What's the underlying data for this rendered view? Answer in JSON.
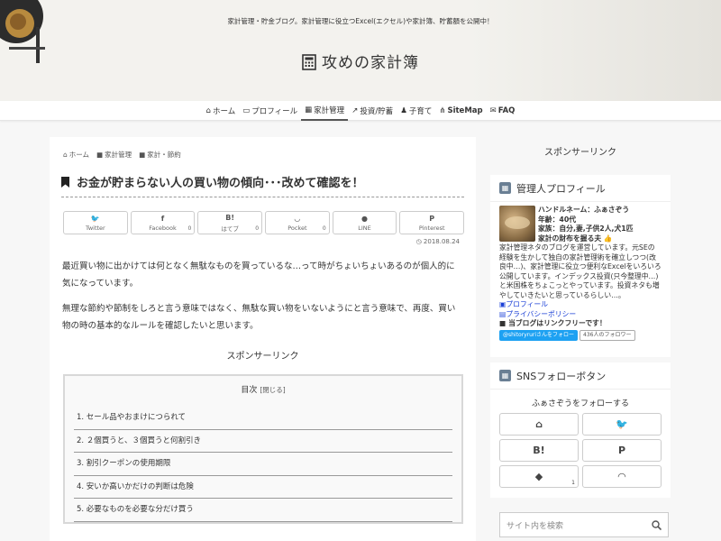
{
  "header": {
    "tagline": "家計管理・貯金ブログ。家計管理に役立つExcel(エクセル)や家計簿、貯蓄額を公開中！",
    "site_title": "攻めの家計簿"
  },
  "nav": [
    {
      "label": "ホーム",
      "icon": "home-icon"
    },
    {
      "label": "プロフィール",
      "icon": "id-card-icon"
    },
    {
      "label": "家計管理",
      "icon": "calculator-icon"
    },
    {
      "label": "投資/貯蓄",
      "icon": "chart-icon"
    },
    {
      "label": "子育て",
      "icon": "child-icon"
    },
    {
      "label": "SiteMap",
      "icon": "sitemap-icon"
    },
    {
      "label": "FAQ",
      "icon": "mail-icon"
    }
  ],
  "breadcrumb": [
    "ホーム",
    "家計管理",
    "家計・節約"
  ],
  "post": {
    "title": "お金が貯まらない人の買い物の傾向･･･改めて確認を！",
    "date": "2018.08.24",
    "para1": "最近買い物に出かけては何となく無駄なものを買っているな…って時がちょいちょいあるのが個人的に気になっています。",
    "para2": "無理な節約や節制をしろと言う意味ではなく、無駄な買い物をいないようにと言う意味で、再度、買い物の時の基本的なルールを確認したいと思います。",
    "sponsor": "スポンサーリンク"
  },
  "shares": [
    {
      "icon": "twitter-icon",
      "glyph": "🐦",
      "label": "Twitter",
      "count": ""
    },
    {
      "icon": "facebook-icon",
      "glyph": "f",
      "label": "Facebook",
      "count": "0"
    },
    {
      "icon": "hatena-icon",
      "glyph": "B!",
      "label": "はてブ",
      "count": "0"
    },
    {
      "icon": "pocket-icon",
      "glyph": "◡",
      "label": "Pocket",
      "count": "0"
    },
    {
      "icon": "line-icon",
      "glyph": "●",
      "label": "LINE",
      "count": ""
    },
    {
      "icon": "pinterest-icon",
      "glyph": "P",
      "label": "Pinterest",
      "count": ""
    }
  ],
  "toc": {
    "title": "目次",
    "toggle": "[閉じる]",
    "items": [
      "1. セール品やおまけにつられて",
      "2. ２個買うと、３個買うと何割引き",
      "3. 割引クーポンの使用期限",
      "4. 安いか高いかだけの判断は危険",
      "5. 必要なものを必要な分だけ買う"
    ]
  },
  "sidebar": {
    "sponsor": "スポンサーリンク",
    "profile_heading": "管理人プロフィール",
    "profile": {
      "handle": "ハンドルネーム：ふぁさぞう",
      "age": "年齢：40代",
      "family": "家族：自分,妻,子供2人,犬1匹",
      "treasurer": "家計の財布を握る夫 👍",
      "bio": "家計管理ネタのブログを運営しています。元SEの経験を生かして独自の家計管理術を確立しつつ(改良中…)、家計管理に役立つ便利なExcelをいろいろ公開しています。インデックス投資(只今整理中…)と米国株をちょこっとやっています。投資ネタも増やしていきたいと思っているらしい…。",
      "link_profile": "プロフィール",
      "link_privacy": "プライバシーポリシー",
      "link_free": "当ブログはリンクフリーです！",
      "follow_button": "@shitoryruriさんをフォロー",
      "follower_count": "436人のフォロワー"
    },
    "sns_heading": "SNSフォローボタン",
    "follow_label": "ふぁさぞうをフォローする",
    "sns": [
      {
        "icon": "home-icon",
        "glyph": "⌂",
        "count": ""
      },
      {
        "icon": "twitter-icon",
        "glyph": "🐦",
        "count": ""
      },
      {
        "icon": "hatena-icon",
        "glyph": "B!",
        "count": ""
      },
      {
        "icon": "pinterest-icon",
        "glyph": "P",
        "count": ""
      },
      {
        "icon": "feedly-icon",
        "glyph": "◆",
        "count": "1"
      },
      {
        "icon": "rss-icon",
        "glyph": "◠",
        "count": ""
      }
    ],
    "search_placeholder": "サイト内を検索"
  }
}
